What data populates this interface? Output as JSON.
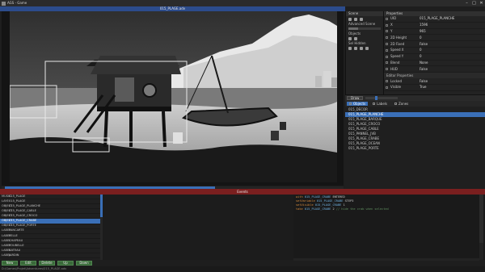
{
  "window": {
    "title": "AGS - Game"
  },
  "viewport": {
    "tab_title": "015_PLAGE.adv"
  },
  "tools": {
    "header": "Scene",
    "groups": [
      "Advanced Scene",
      "Objects",
      "Sel Hidden"
    ]
  },
  "properties": {
    "header": "Properties",
    "rows": [
      {
        "key": "UID",
        "value": "015_PLAGE_PLANCHE"
      },
      {
        "key": "X",
        "value": "1596"
      },
      {
        "key": "Y",
        "value": "965"
      },
      {
        "key": "2D Height",
        "value": "0"
      },
      {
        "key": "2D Fixed",
        "value": "False"
      },
      {
        "key": "Speed X",
        "value": "0"
      },
      {
        "key": "Speed Y",
        "value": "0"
      },
      {
        "key": "Blend",
        "value": "None"
      },
      {
        "key": "HUD",
        "value": "False"
      }
    ],
    "subheader": "Editor Properties",
    "editor_rows": [
      {
        "key": "Locked",
        "value": "False"
      },
      {
        "key": "Visible",
        "value": "True"
      }
    ]
  },
  "objects": {
    "draw_label": "Draw",
    "tabs": [
      "Objects",
      "Labels",
      "Zones"
    ],
    "items": [
      "015_DECOR",
      "015_PLAGE_PLANCHE",
      "015_PLAGE_BARQUE",
      "015_PLAGE_CROCO",
      "015_PLAGE_CABLE",
      "015_PANNEL_JVB",
      "015_PLAGE_CRABE",
      "015_PLAGE_OCEAN",
      "015_PLAGE_PORTE"
    ],
    "selected_index": 1
  },
  "bottom_bar": {
    "label": "Events"
  },
  "commands": {
    "rows": [
      {
        "a": "MUSIC",
        "b": "015_PLAGE"
      },
      {
        "a": "LAYE",
        "b": "015_PLAGE"
      },
      {
        "a": "OBJECT",
        "b": "015_PLAGE_PLANCHE"
      },
      {
        "a": "OBJECT",
        "b": "015_PLAGE_CABLE"
      },
      {
        "a": "OBJECT",
        "b": "015_PLAGE_CROCO"
      },
      {
        "a": "OBJECT",
        "b": "015_PLAGE_CRABE"
      },
      {
        "a": "OBJECT",
        "b": "015_PLAGE_PORTE"
      },
      {
        "a": "LABEL",
        "b": "PANCARTE"
      },
      {
        "a": "LABEL",
        "b": "PELLE"
      },
      {
        "a": "LABEL",
        "b": "CHAPEAU"
      },
      {
        "a": "LABEL",
        "b": "POUBELLE"
      },
      {
        "a": "LABEL",
        "b": "BATEAU"
      },
      {
        "a": "LABEL",
        "b": "JARDIN"
      }
    ],
    "selected_index": 5,
    "buttons": [
      "New",
      "Edit",
      "Delete",
      "Up",
      "Down"
    ]
  },
  "code": {
    "lines": [
      {
        "kw": "with",
        "id": "015_PLAGE_CRABE",
        "rest": " ENTERED"
      },
      {
        "kw": "setVariable",
        "id": "015_PLAGE_CRABE",
        "rest": " STEP3"
      },
      {
        "kw": "setVisible",
        "id": "015_PLAGE_CRABE",
        "rest": " 1"
      },
      {
        "kw": "take",
        "id": "015_PLAGE_CRABE",
        "rest": " 2",
        "comment": " // hide the crab when selected"
      }
    ]
  },
  "status": {
    "text": "D:\\Games\\Projet\\Adventures\\015_PLAGE.adv"
  }
}
